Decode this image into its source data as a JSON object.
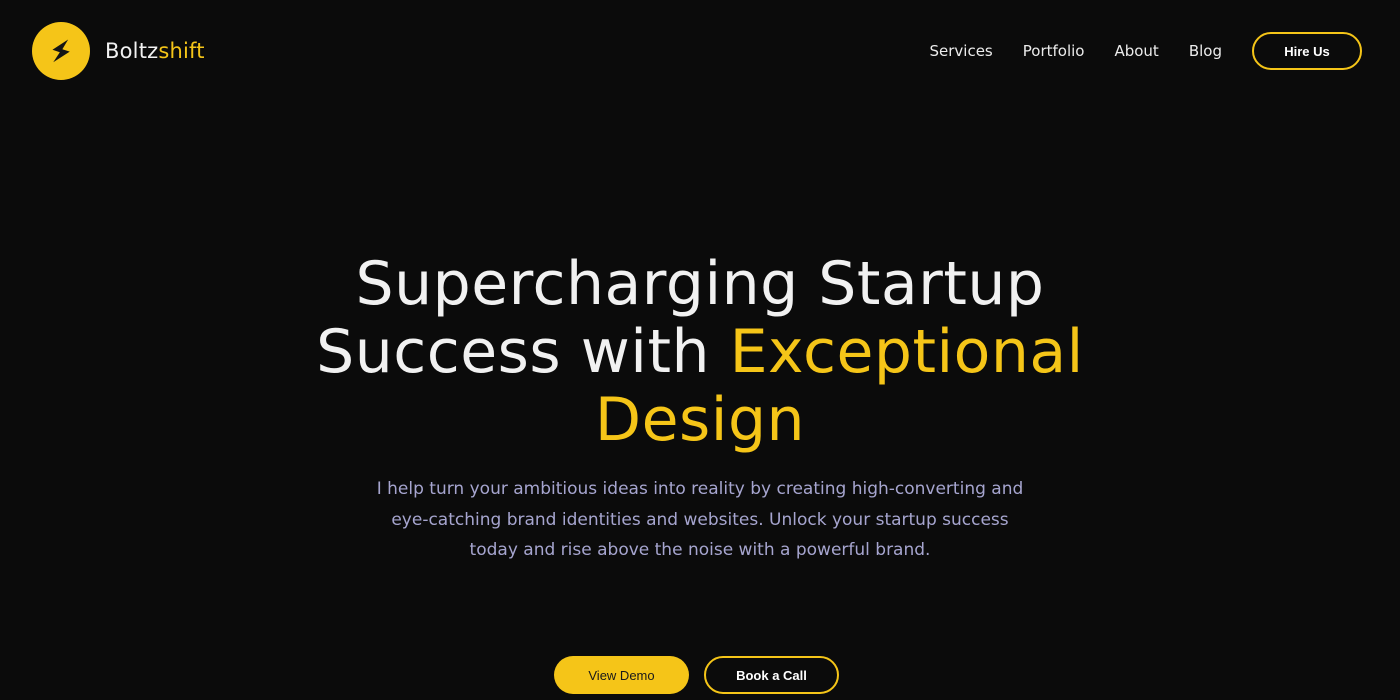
{
  "brand": {
    "name_part1": "Boltz",
    "name_part2": "shift",
    "logo_icon": "lightning-bolt-icon",
    "accent_color": "#f5c518",
    "background_color": "#0b0b0b"
  },
  "nav": {
    "items": [
      {
        "label": "Services"
      },
      {
        "label": "Portfolio"
      },
      {
        "label": "About"
      },
      {
        "label": "Blog"
      }
    ],
    "cta_label": "Hire Us"
  },
  "hero": {
    "title_line1": "Supercharging Startup",
    "title_line2_plain": "Success with ",
    "title_line2_highlight": "Exceptional",
    "title_line3_highlight": "Design",
    "subtitle": "I help turn your ambitious ideas into reality by creating high-converting and eye-catching brand identities and websites. Unlock your startup success today and rise above the noise with a powerful brand.",
    "primary_button": "View Demo",
    "secondary_button": "Book a Call"
  }
}
